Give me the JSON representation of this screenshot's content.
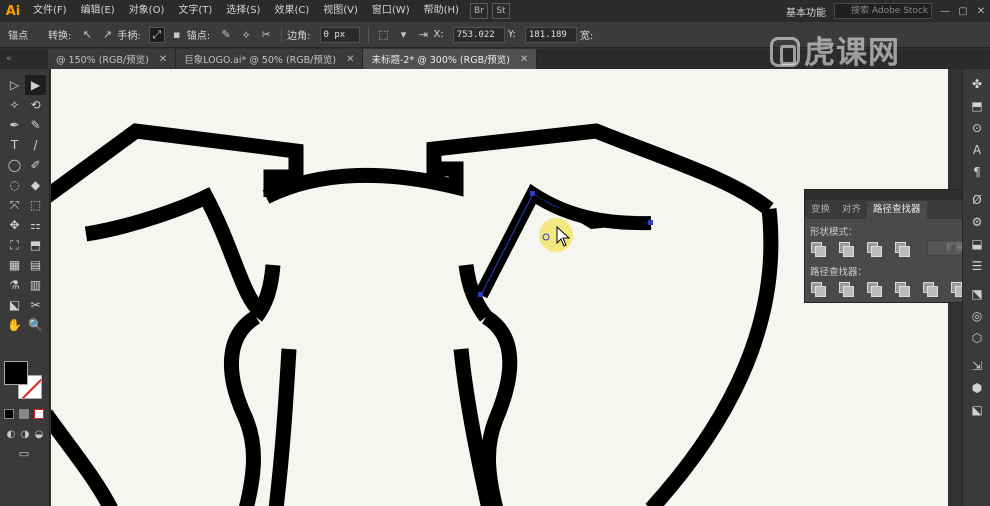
{
  "app": {
    "logo_text": "Ai"
  },
  "menu": {
    "items": [
      "文件(F)",
      "编辑(E)",
      "对象(O)",
      "文字(T)",
      "选择(S)",
      "效果(C)",
      "视图(V)",
      "窗口(W)",
      "帮助(H)"
    ],
    "bridge_label": "Br",
    "stock_label": "St",
    "workspace_label": "基本功能",
    "stock_search_placeholder": "搜索 Adobe Stock",
    "minimize": "—",
    "maximize": "▢",
    "close": "✕"
  },
  "control_bar": {
    "anchor_label": "锚点",
    "convert_label": "转换:",
    "handles_label": "手柄:",
    "anchor_point_label": "锚点:",
    "corner_label": "边角:",
    "corner_value": "0 px",
    "x_label": "X:",
    "x_value": "753.022",
    "y_label": "Y:",
    "y_value": "181.189",
    "width_label": "宽:"
  },
  "doc_tabs": {
    "collapse_glyph": "«",
    "tabs": [
      {
        "label": "@ 150% (RGB/预览)",
        "close": "✕",
        "active": false
      },
      {
        "label": "巨象LOGO.ai* @ 50% (RGB/预览)",
        "close": "✕",
        "active": false
      },
      {
        "label": "未标题-2* @ 300% (RGB/预览)",
        "close": "✕",
        "active": true
      }
    ]
  },
  "tools": {
    "rows": [
      [
        "▷",
        "▶"
      ],
      [
        "✧",
        "⟲"
      ],
      [
        "✒",
        "✎"
      ],
      [
        "T",
        "/"
      ],
      [
        "◯",
        "✐"
      ],
      [
        "◌",
        "◆"
      ],
      [
        "⤧",
        "⬚"
      ],
      [
        "✥",
        "⚏"
      ],
      [
        "⛶",
        "⬒"
      ],
      [
        "▦",
        "▤"
      ],
      [
        "⚗",
        "▥"
      ],
      [
        "⬕",
        "✂"
      ],
      [
        "✋",
        "🔍"
      ]
    ],
    "draw_modes": [
      "◐",
      "◑",
      "◒"
    ],
    "screen_mode": "▭"
  },
  "pathfinder_panel": {
    "collapse_glyph": "» ✕",
    "tabs": [
      "变换",
      "对齐",
      "路径查找器"
    ],
    "active_tab": 2,
    "menu_glyph": "≡",
    "shape_modes_label": "形状模式：",
    "expand_label": "扩展",
    "pathfinders_label": "路径查找器："
  },
  "right_dock": {
    "icons": [
      "✤",
      "⬒",
      "⊙",
      "A",
      "¶",
      "Ø",
      "⚙",
      "⬓",
      "☰",
      "⬔",
      "◎",
      "⬡",
      "⇲",
      "⬢",
      "⬕"
    ]
  },
  "watermark": {
    "text": "虎课网"
  },
  "colors": {
    "accent_highlight": "#f2e35a",
    "selection_blue": "#2a3fbf",
    "canvas_bg": "#f6f6f1"
  }
}
